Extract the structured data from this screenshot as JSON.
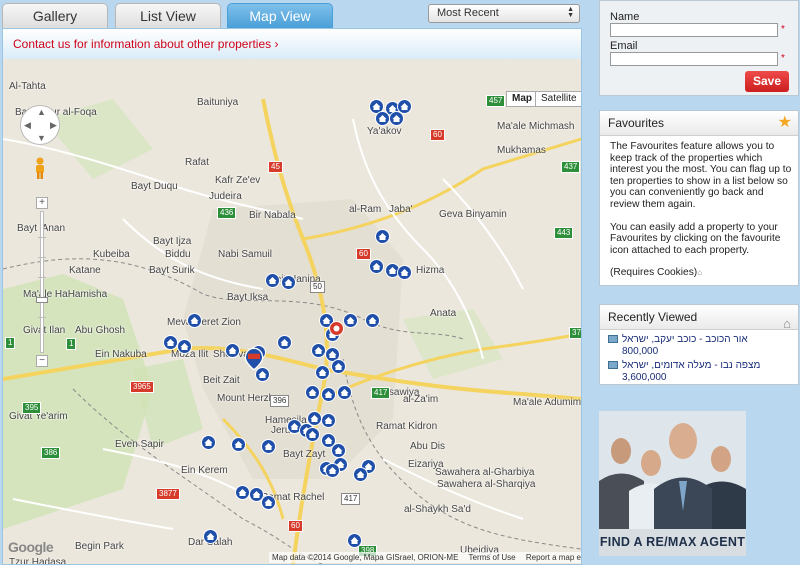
{
  "tabs": {
    "gallery": "Gallery",
    "list": "List View",
    "map": "Map View"
  },
  "sort": {
    "value": "Most Recent"
  },
  "contact_link": "Contact us for information about other properties",
  "map": {
    "map_btn": "Map",
    "satellite_btn": "Satellite",
    "places": [
      "Al-Tahta",
      "Baituniya",
      "Bayt Ghur al-Foqa",
      "Ya'akov",
      "Ma'ale Michmash",
      "Rafat",
      "Mukhamas",
      "Bayt Duqu",
      "Kafr Ze'ev",
      "Judeira",
      "Jaba'",
      "Bayt 'Anan",
      "Bir Nabala",
      "al-Ram",
      "Geva Binyamin",
      "Bayt Ijza",
      "Kubeiba",
      "Biddu",
      "Nabi Samuil",
      "Beit Hanina",
      "Hizma",
      "Katane",
      "Bayt Surik",
      "Ma'ale HaHamisha",
      "Bayt Iksa",
      "Anata",
      "Givat Ilan",
      "Abu Ghosh",
      "Mevasseret Zion",
      "Ein Nakuba",
      "Moza Ilit",
      "Sho'eva",
      "Beit Zait",
      "Givat Ye'arim",
      "Even Sapir",
      "Ein Kerem",
      "Mount Herzl",
      "Jerusalem",
      "al-Isawiya",
      "Abu Dis",
      "al-Za'im",
      "Ma'ale Adumim",
      "Eizariya",
      "Sawahera al-Gharbiya",
      "Sawahera al-Sharqiya",
      "Ramat Rachel",
      "al-Shaykh Sa'd",
      "Tzur Hadasa",
      "Begin Park",
      "Ubeidiya",
      "Dar Salah",
      "Ramat Kidron",
      "Hamesila",
      "Bayt Zayt"
    ],
    "roads": [
      "457",
      "60",
      "45",
      "437",
      "436",
      "443",
      "1",
      "50",
      "60",
      "417",
      "3965",
      "395",
      "386",
      "3877",
      "60",
      "417",
      "398",
      "1",
      "375",
      "396"
    ],
    "attribution": [
      "Map data ©2014 Google, Mapa GISrael, ORION-ME",
      "Terms of Use",
      "Report a map error"
    ],
    "google": "Google"
  },
  "signup": {
    "name_label": "Name",
    "email_label": "Email",
    "required_mark": "*",
    "save": "Save"
  },
  "favourites": {
    "title": "Favourites",
    "para1": "The Favourites feature allows you to keep track of the properties which interest you the most.  You can flag up to ten properties to show in a list below so you can conveniently go back and review them again.",
    "para2": "You can easily add a property to your Favourites by clicking on the favourite icon attached to each property.",
    "cookies": "(Requires Cookies)"
  },
  "recent": {
    "title": "Recently Viewed",
    "items": [
      {
        "title": "אור הכוכב - כוכב יעקב, ישראל",
        "price": "800,000"
      },
      {
        "title": "מצפה נבו - מעלה אדומים, ישראל",
        "price": "3,600,000"
      }
    ]
  },
  "agent": {
    "caption": "FIND A RE/MAX AGENT"
  },
  "colors": {
    "accent": "#4a9fd8",
    "link_red": "#d0021b",
    "save_red": "#cc1f1f",
    "pin_blue": "#1f4fa8"
  }
}
